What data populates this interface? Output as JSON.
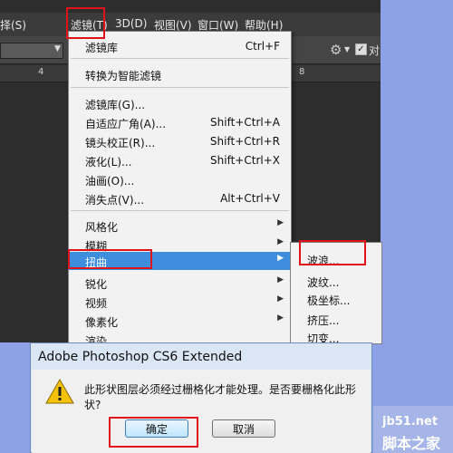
{
  "menubar": {
    "items": [
      "择(S)",
      "滤镜(T)",
      "3D(D)",
      "视图(V)",
      "窗口(W)",
      "帮助(H)"
    ]
  },
  "optionsbar": {
    "checkbox_label": "对"
  },
  "ruler": {
    "numbers": [
      "4",
      "8"
    ]
  },
  "filter_menu": {
    "items": [
      {
        "label": "滤镜库",
        "shortcut": "Ctrl+F"
      },
      {
        "label": "转换为智能滤镜",
        "shortcut": ""
      },
      {
        "label": "滤镜库(G)...",
        "shortcut": ""
      },
      {
        "label": "自适应广角(A)...",
        "shortcut": "Shift+Ctrl+A"
      },
      {
        "label": "镜头校正(R)...",
        "shortcut": "Shift+Ctrl+R"
      },
      {
        "label": "液化(L)...",
        "shortcut": "Shift+Ctrl+X"
      },
      {
        "label": "油画(O)...",
        "shortcut": ""
      },
      {
        "label": "消失点(V)...",
        "shortcut": "Alt+Ctrl+V"
      },
      {
        "label": "风格化",
        "shortcut": ""
      },
      {
        "label": "模糊",
        "shortcut": ""
      },
      {
        "label": "扭曲",
        "shortcut": ""
      },
      {
        "label": "锐化",
        "shortcut": ""
      },
      {
        "label": "视频",
        "shortcut": ""
      },
      {
        "label": "像素化",
        "shortcut": ""
      },
      {
        "label": "渲染",
        "shortcut": ""
      }
    ],
    "submenu_arrow": "▶"
  },
  "submenu": {
    "items": [
      "波浪...",
      "波纹...",
      "极坐标...",
      "挤压...",
      "切变..."
    ]
  },
  "dialog": {
    "title": "Adobe Photoshop CS6 Extended",
    "message": "此形状图层必须经过栅格化才能处理。是否要栅格化此形状?",
    "ok_label": "确定",
    "cancel_label": "取消"
  },
  "watermark": {
    "line1": "jb51.net",
    "line2": "脚本之家"
  },
  "colors": {
    "highlight": "#3e8edd",
    "annotation_red": "#e0131b"
  }
}
